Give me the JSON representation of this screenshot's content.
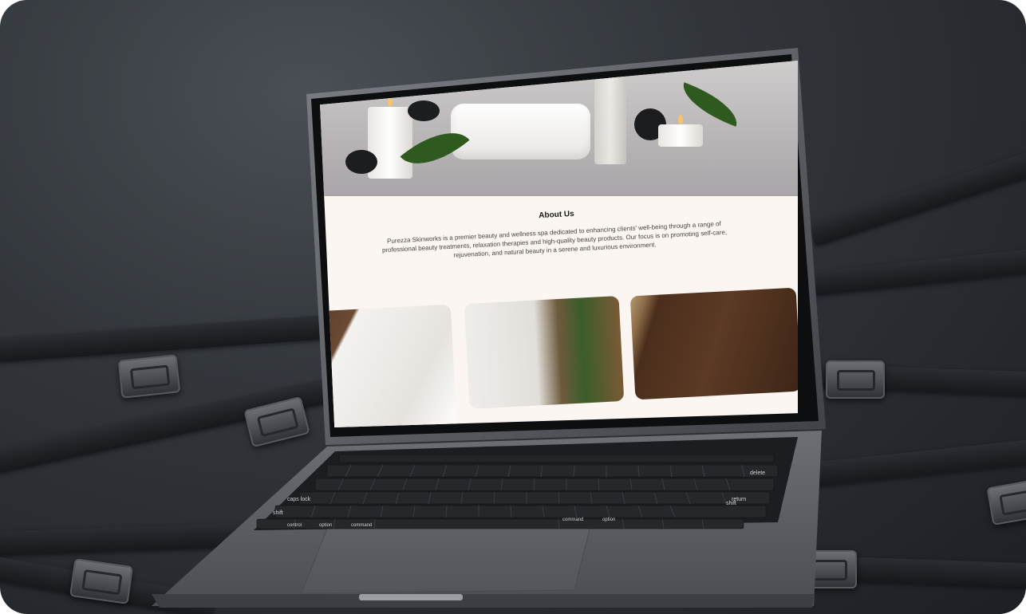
{
  "about": {
    "title": "About Us",
    "text": "Purezza Skinworks is a premier beauty and wellness spa dedicated to enhancing clients' well-being through a range of professional beauty treatments, relaxation therapies and high-quality beauty products. Our focus is on promoting self-care, rejuvenation, and natural beauty in a serene and luxurious environment."
  },
  "keyboard": {
    "delete": "delete",
    "return": "return",
    "caps_lock": "caps lock",
    "shift_left": "shift",
    "shift_right": "shift",
    "control": "control",
    "option_left": "option",
    "command_left": "command",
    "command_right": "command",
    "option_right": "option"
  },
  "colors": {
    "page_bg": "#fbf6f2",
    "hero_bg": "#b8b4b6",
    "backdrop": "#32363b",
    "laptop_body": "#5b5e63"
  },
  "icons": [
    "notch-camera-icon",
    "towel-image",
    "candle-image",
    "basket-image",
    "wood-image"
  ]
}
